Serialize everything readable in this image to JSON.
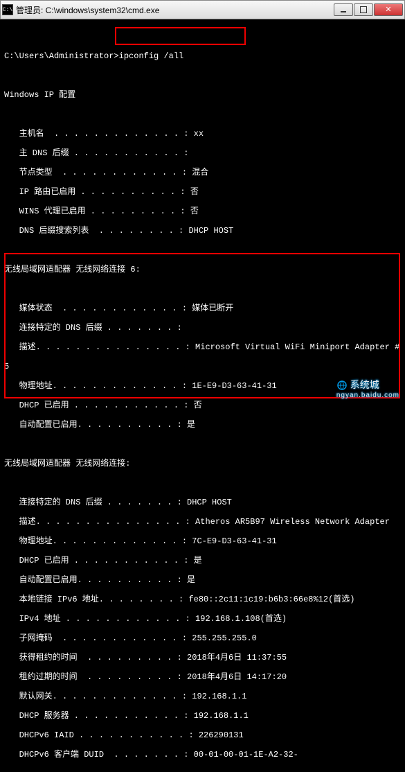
{
  "titlebar": {
    "icon_label": "C:\\",
    "title": "管理员: C:\\windows\\system32\\cmd.exe"
  },
  "prompt": {
    "path": "C:\\Users\\Administrator>",
    "command": "ipconfig /all"
  },
  "header": "Windows IP 配置",
  "global": {
    "hostname_label": "   主机名  . . . . . . . . . . . . . : ",
    "hostname_value": "xx",
    "dns_suffix_label": "   主 DNS 后缀 . . . . . . . . . . . : ",
    "dns_suffix_value": "",
    "node_type_label": "   节点类型  . . . . . . . . . . . . : ",
    "node_type_value": "混合",
    "ip_routing_label": "   IP 路由已启用 . . . . . . . . . . : ",
    "ip_routing_value": "否",
    "wins_proxy_label": "   WINS 代理已启用 . . . . . . . . . : ",
    "wins_proxy_value": "否",
    "dns_search_label": "   DNS 后缀搜索列表  . . . . . . . . : ",
    "dns_search_value": "DHCP HOST"
  },
  "adapter6": {
    "title": "无线局域网适配器 无线网络连接 6:",
    "media_label": "   媒体状态  . . . . . . . . . . . . : ",
    "media_value": "媒体已断开",
    "conn_dns_label": "   连接特定的 DNS 后缀 . . . . . . . : ",
    "conn_dns_value": "",
    "desc_label": "   描述. . . . . . . . . . . . . . . : ",
    "desc_value": "Microsoft Virtual WiFi Miniport Adapter #",
    "desc_line2": "5",
    "phys_label": "   物理地址. . . . . . . . . . . . . : ",
    "phys_value": "1E-E9-D3-63-41-31",
    "dhcp_label": "   DHCP 已启用 . . . . . . . . . . . : ",
    "dhcp_value": "否",
    "auto_label": "   自动配置已启用. . . . . . . . . . : ",
    "auto_value": "是"
  },
  "adapter_wlan": {
    "title": "无线局域网适配器 无线网络连接:",
    "conn_dns_label": "   连接特定的 DNS 后缀 . . . . . . . : ",
    "conn_dns_value": "DHCP HOST",
    "desc_label": "   描述. . . . . . . . . . . . . . . : ",
    "desc_value": "Atheros AR5B97 Wireless Network Adapter",
    "phys_label": "   物理地址. . . . . . . . . . . . . : ",
    "phys_value": "7C-E9-D3-63-41-31",
    "dhcp_label": "   DHCP 已启用 . . . . . . . . . . . : ",
    "dhcp_value": "是",
    "auto_label": "   自动配置已启用. . . . . . . . . . : ",
    "auto_value": "是",
    "ipv6_label": "   本地链接 IPv6 地址. . . . . . . . : ",
    "ipv6_value": "fe80::2c11:1c19:b6b3:66e8%12(首选)",
    "ipv4_label": "   IPv4 地址 . . . . . . . . . . . . : ",
    "ipv4_value": "192.168.1.108(首选)",
    "mask_label": "   子网掩码  . . . . . . . . . . . . : ",
    "mask_value": "255.255.255.0",
    "lease_obt_label": "   获得租约的时间  . . . . . . . . . : ",
    "lease_obt_value": "2018年4月6日 11:37:55",
    "lease_exp_label": "   租约过期的时间  . . . . . . . . . : ",
    "lease_exp_value": "2018年4月6日 14:17:20",
    "gateway_label": "   默认网关. . . . . . . . . . . . . : ",
    "gateway_value": "192.168.1.1",
    "dhcp_srv_label": "   DHCP 服务器 . . . . . . . . . . . : ",
    "dhcp_srv_value": "192.168.1.1",
    "iaid_label": "   DHCPv6 IAID . . . . . . . . . . . : ",
    "iaid_value": "226290131",
    "duid_label": "   DHCPv6 客户端 DUID  . . . . . . . : ",
    "duid_value": "00-01-00-01-1E-A2-32-"
  },
  "watermark": {
    "brand": "系统城",
    "url": "ngyan.baidu.com"
  }
}
